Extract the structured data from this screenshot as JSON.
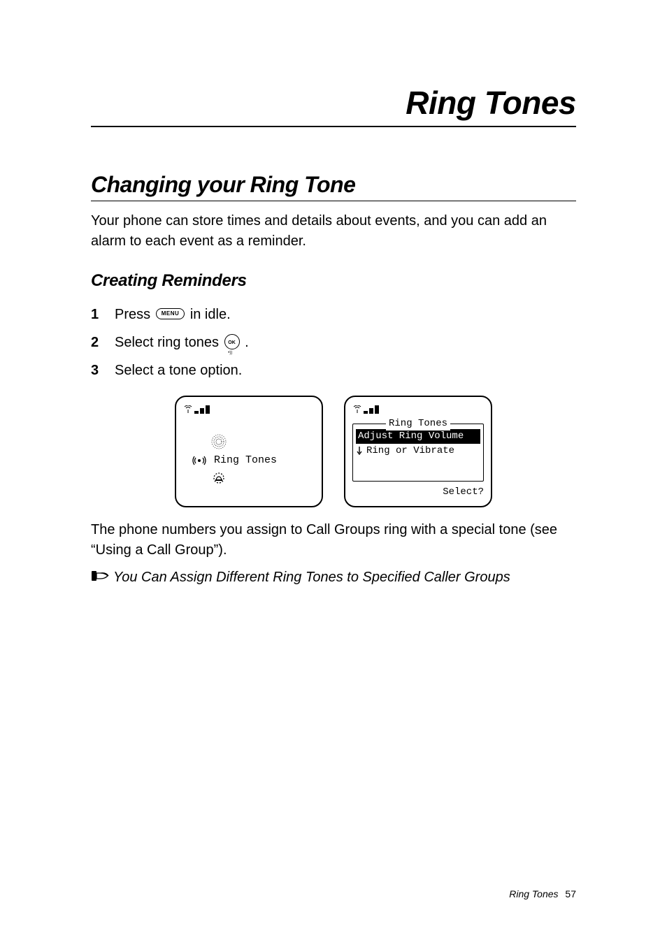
{
  "page_title": "Ring Tones",
  "section_heading": "Changing your Ring Tone",
  "intro_paragraph": "Your phone can store times and details about events, and you can add an alarm to each event as a reminder.",
  "subheading": "Creating Reminders",
  "steps": [
    {
      "num": "1",
      "pre": "Press ",
      "button": "MENU",
      "post": " in idle."
    },
    {
      "num": "2",
      "pre": "Select ring tones ",
      "button": "OK",
      "post": "."
    },
    {
      "num": "3",
      "pre": "Select a tone option.",
      "button": "",
      "post": ""
    }
  ],
  "screen1": {
    "label": "Ring Tones"
  },
  "screen2": {
    "legend": "Ring Tones",
    "items": [
      {
        "label": "Adjust Ring Volume",
        "selected": true
      },
      {
        "label": "Ring or Vibrate",
        "selected": false
      }
    ],
    "prompt": "Select?"
  },
  "after_screens_paragraph": "The phone numbers you assign to Call Groups ring with a special tone (see “Using a Call Group”).",
  "note_text": "You Can Assign Different Ring Tones to Specified Caller Groups",
  "footer_label": "Ring Tones",
  "footer_page": "57",
  "icons": {
    "menu_button": "MENU",
    "ok_button_top": "OK",
    "ok_button_dot": "•))"
  }
}
